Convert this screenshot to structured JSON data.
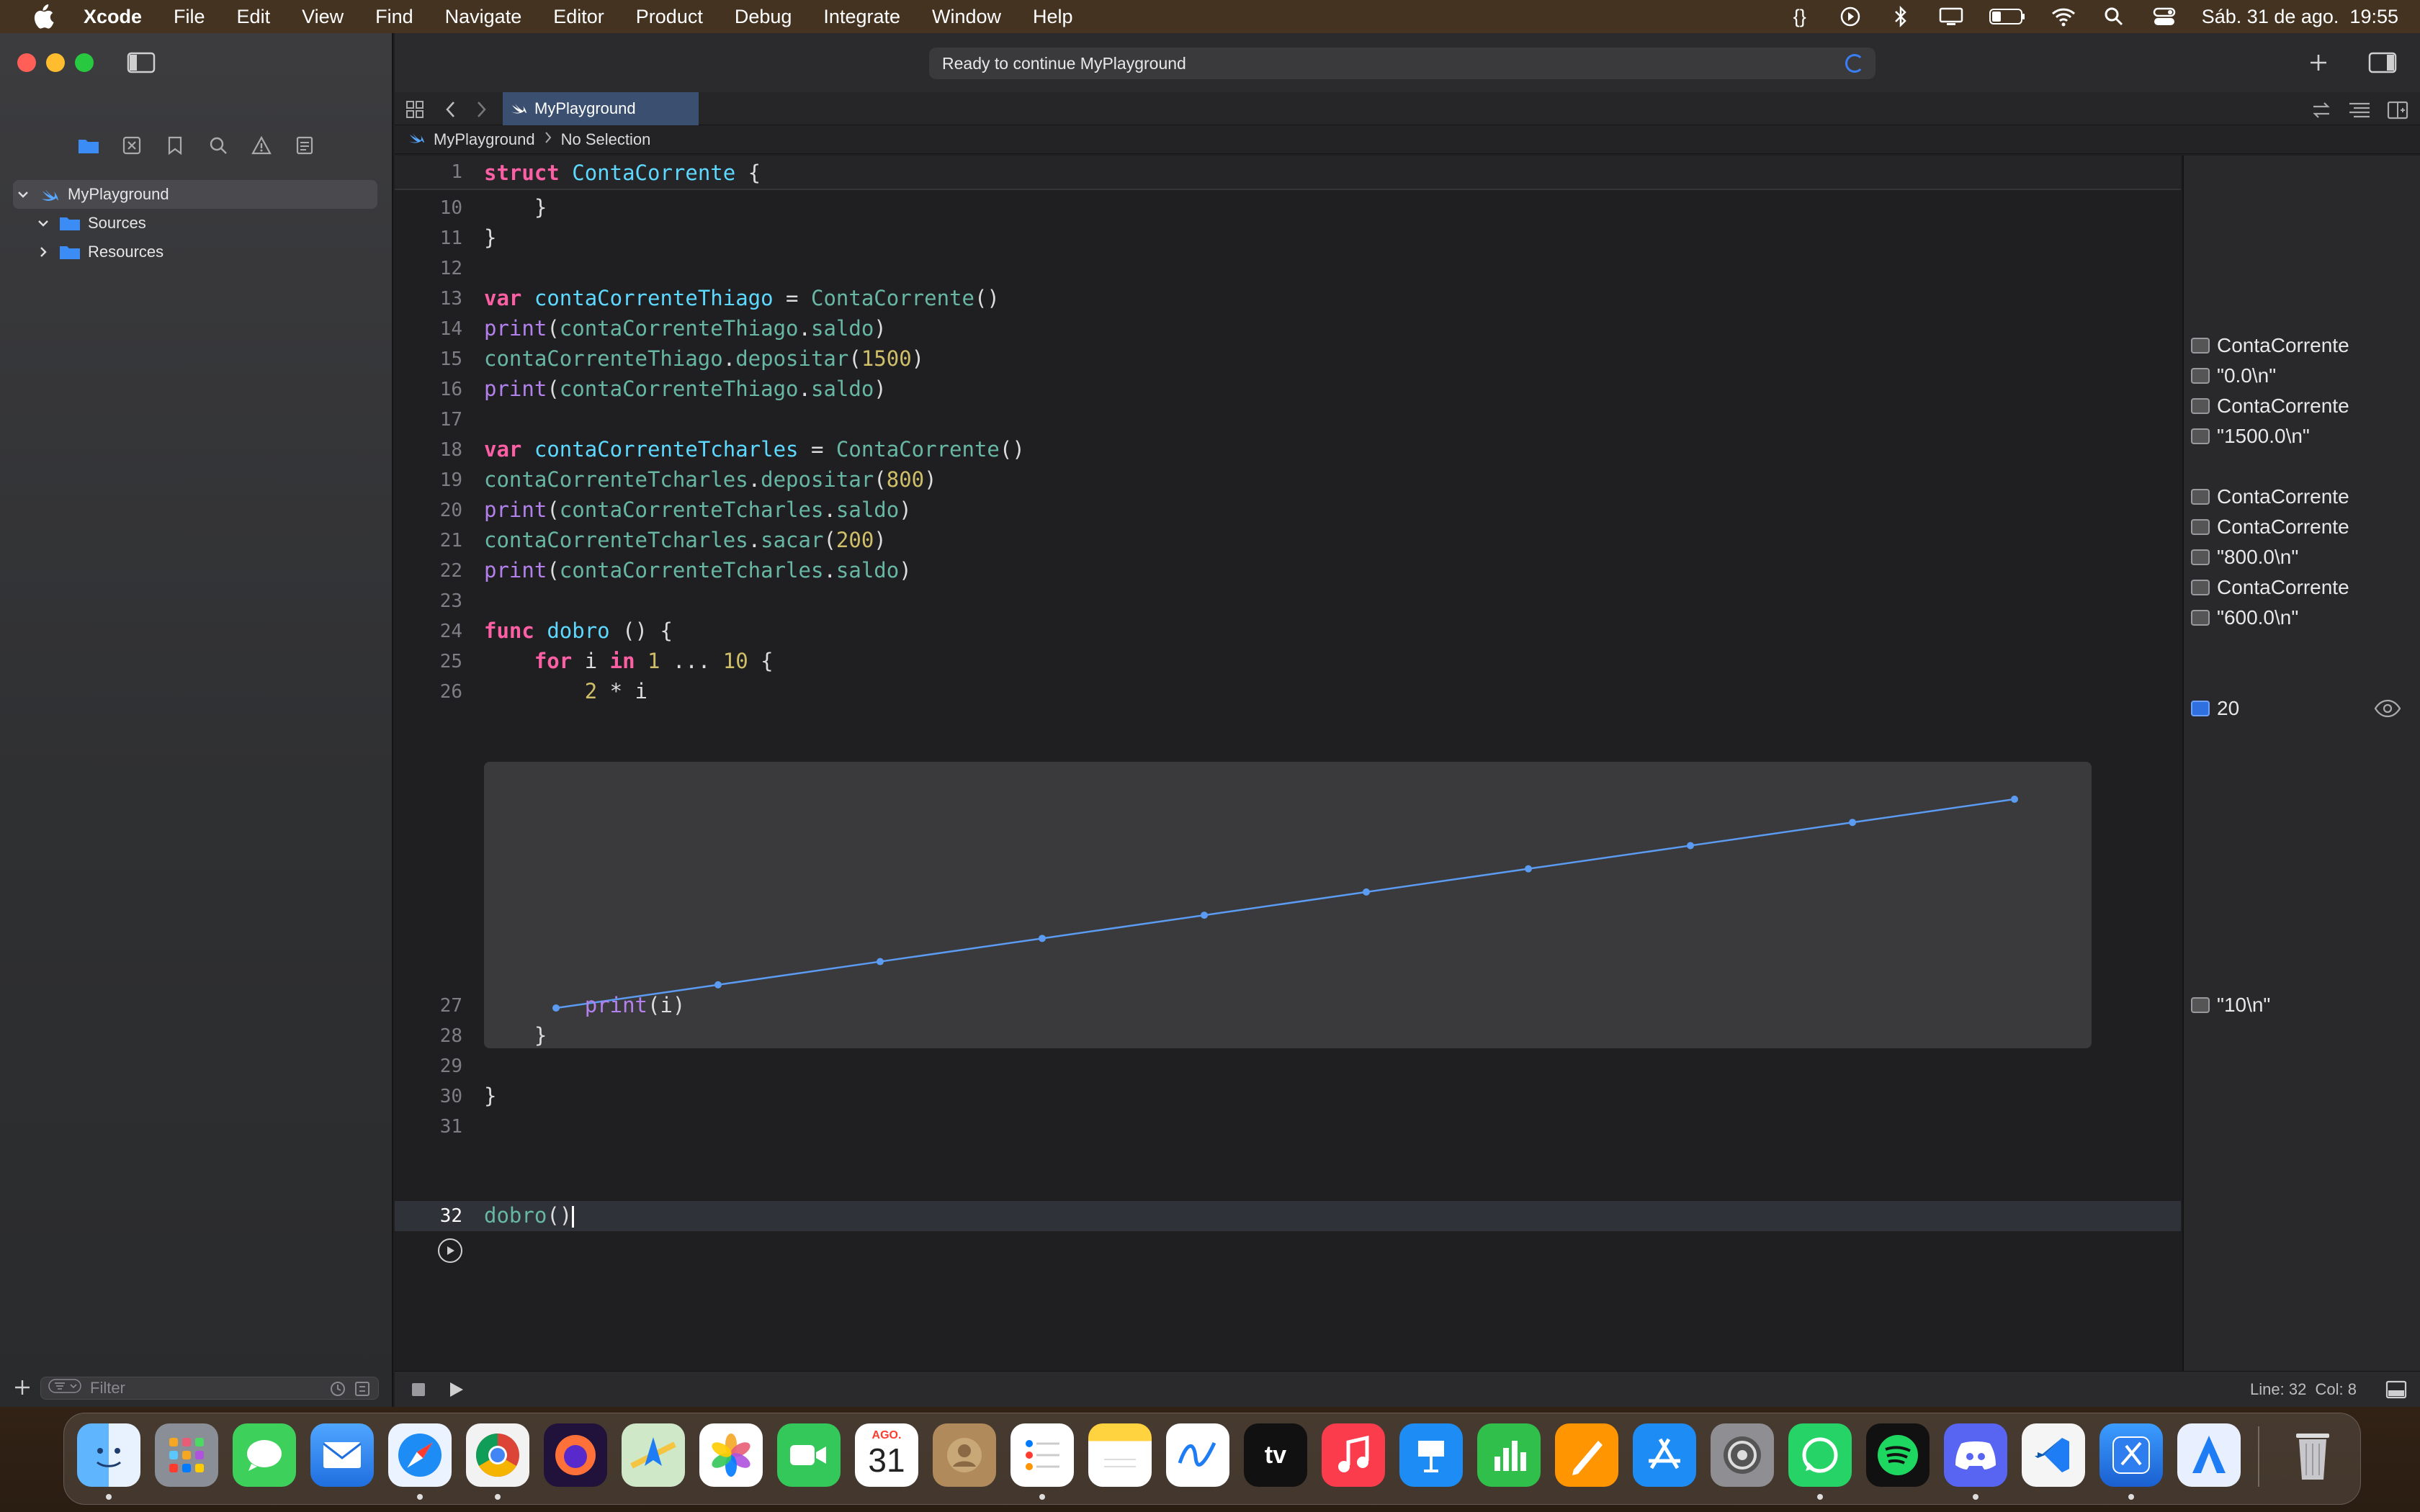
{
  "menubar": {
    "app": "Xcode",
    "items": [
      "File",
      "Edit",
      "View",
      "Find",
      "Navigate",
      "Editor",
      "Product",
      "Debug",
      "Integrate",
      "Window",
      "Help"
    ],
    "datetime": "Sáb. 31 de ago.  19:55",
    "braces": "{}"
  },
  "toolbar": {
    "activity": "Ready to continue MyPlayground",
    "tab": "MyPlayground"
  },
  "jumpbar": {
    "project": "MyPlayground",
    "selection": "No Selection"
  },
  "navigator": {
    "items": [
      {
        "label": "MyPlayground"
      },
      {
        "label": "Sources"
      },
      {
        "label": "Resources"
      }
    ],
    "filter_placeholder": "Filter"
  },
  "code": {
    "sticky": {
      "number": "1",
      "text": "struct ContaCorrente {"
    },
    "current_line": "32"
  },
  "results": [
    {
      "value": "ContaCorrente"
    },
    {
      "value": "\"0.0\\n\""
    },
    {
      "value": "ContaCorrente"
    },
    {
      "value": "\"1500.0\\n\""
    },
    {
      "value": "ContaCorrente"
    },
    {
      "value": "ContaCorrente"
    },
    {
      "value": "\"800.0\\n\""
    },
    {
      "value": "ContaCorrente"
    },
    {
      "value": "\"600.0\\n\""
    },
    {
      "value": "20"
    },
    {
      "value": "\"10\\n\""
    }
  ],
  "statusbar": {
    "position": "Line: 32  Col: 8"
  },
  "dock": {
    "calendar_month": "AGO.",
    "calendar_day": "31",
    "tv": "tv"
  },
  "chart_data": {
    "type": "line",
    "x": [
      1,
      2,
      3,
      4,
      5,
      6,
      7,
      8,
      9,
      10
    ],
    "values": [
      2,
      4,
      6,
      8,
      10,
      12,
      14,
      16,
      18,
      20
    ],
    "color": "#5b9bf2"
  }
}
